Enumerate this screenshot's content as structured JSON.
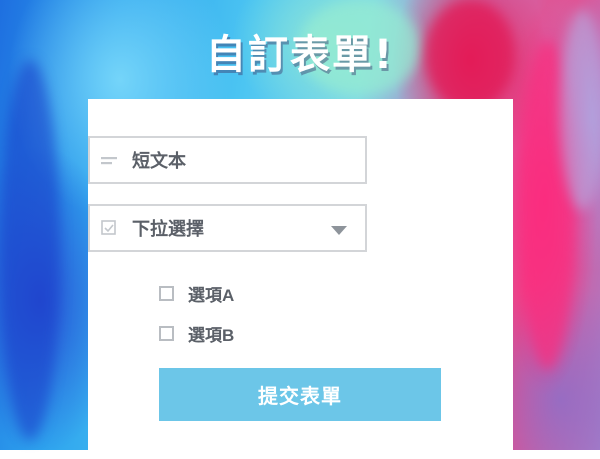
{
  "form": {
    "title": "自訂表單!",
    "short_text_label": "短文本",
    "short_text_icon": "short-text-lines-icon",
    "dropdown_label": "下拉選擇",
    "dropdown_icon": "checkbox-square-icon",
    "dropdown_caret_icon": "caret-down-icon",
    "options": [
      {
        "label": "選項A",
        "checked": false
      },
      {
        "label": "選項B",
        "checked": false
      }
    ],
    "submit_label": "提交表單"
  },
  "colors": {
    "submit_button": "#6cc6e8",
    "field_border": "#d3d5d8",
    "label_text": "#5b6068",
    "card_background": "#ffffff"
  }
}
